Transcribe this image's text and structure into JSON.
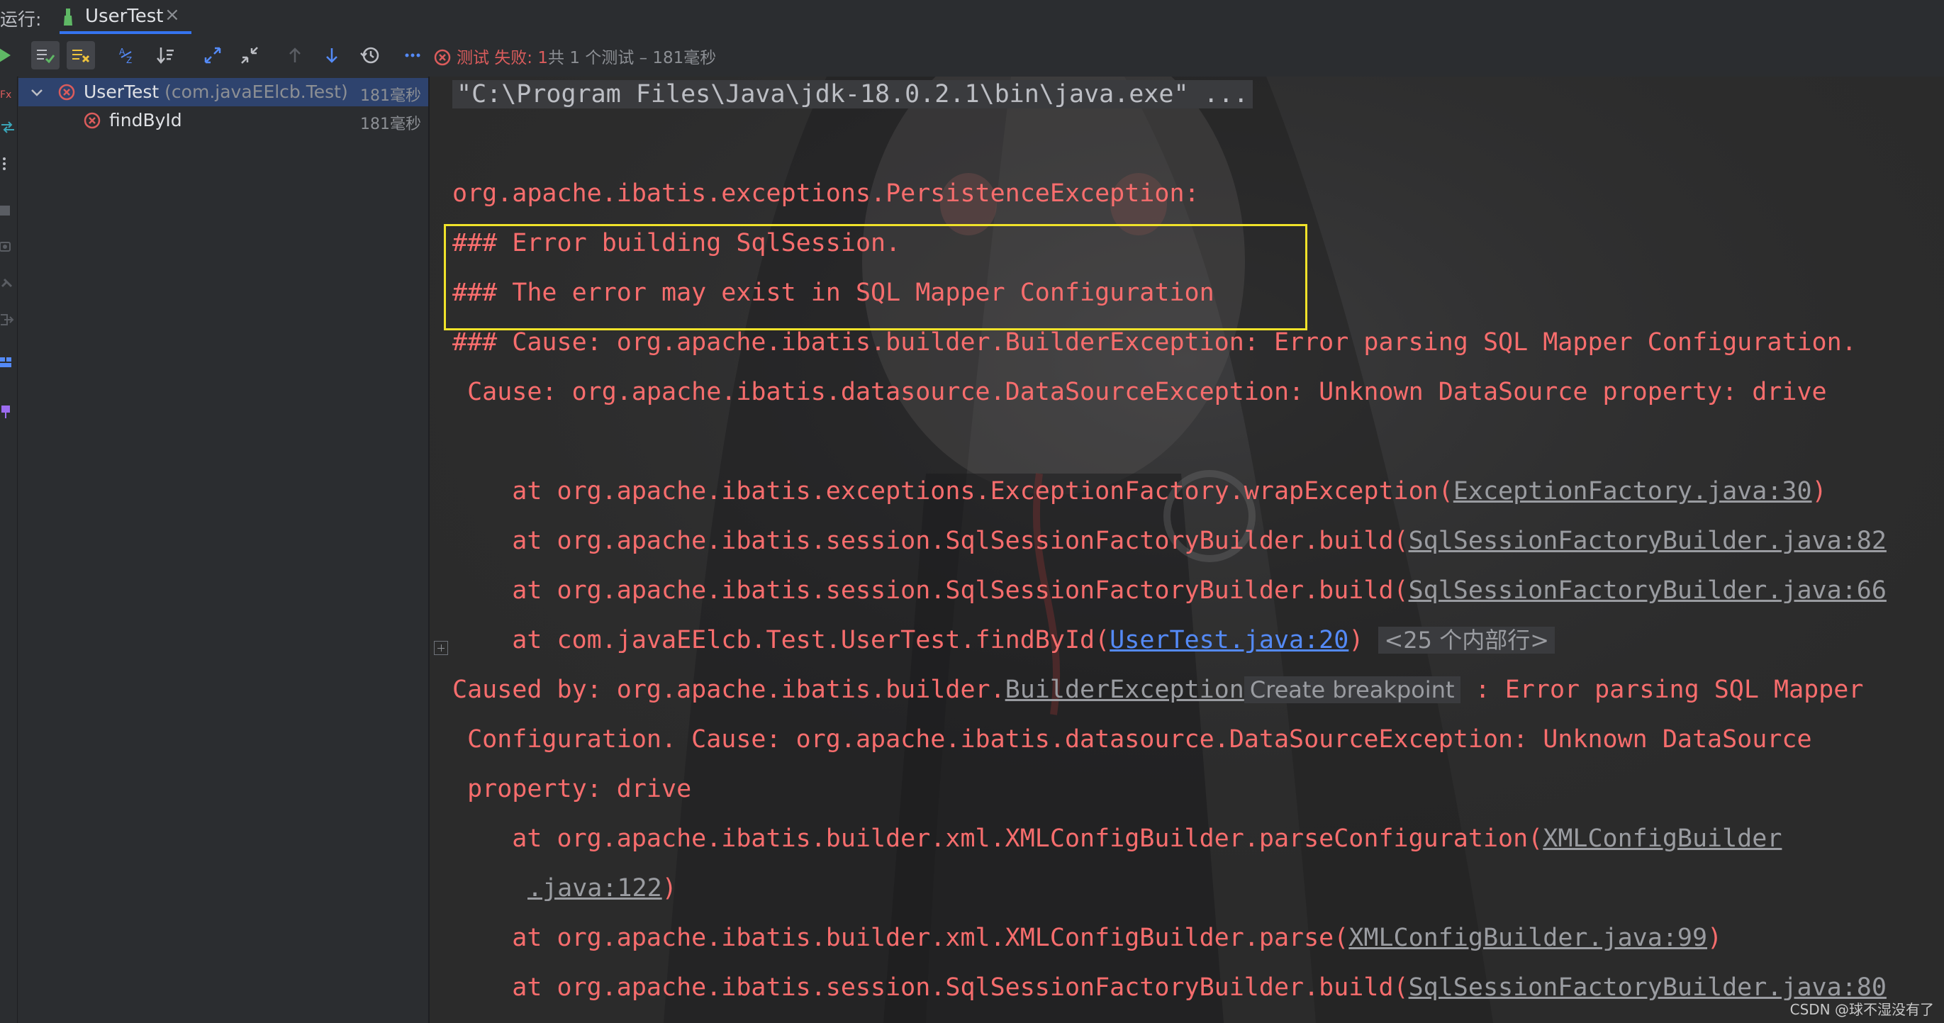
{
  "tabbar": {
    "run_label": "运行:",
    "tab_name": "UserTest",
    "close_glyph": "×"
  },
  "toolbar": {
    "buttons": [
      "rerun-icon",
      "show-passed-icon",
      "show-ignored-icon",
      "sort-alpha-icon",
      "sort-duration-icon",
      "expand-all-icon",
      "collapse-all-icon",
      "prev-failed-icon",
      "next-failed-icon",
      "history-icon",
      "more-icon"
    ],
    "status_prefix": "测试 失败: 1",
    "status_rest": "共 1 个测试 – 181毫秒"
  },
  "tree": {
    "root": {
      "name": "UserTest",
      "pkg": "(com.javaEElcb.Test)",
      "time": "181毫秒"
    },
    "child": {
      "name": "findById",
      "time": "181毫秒"
    }
  },
  "console": {
    "cmd": "\"C:\\Program Files\\Java\\jdk-18.0.2.1\\bin\\java.exe\" ...",
    "l1": "org.apache.ibatis.exceptions.PersistenceException:",
    "l2": "### Error building SqlSession.",
    "l3": "### The error may exist in SQL Mapper Configuration",
    "l4": "### Cause: org.apache.ibatis.builder.BuilderException: Error parsing SQL Mapper Configuration.",
    "l5": " Cause: org.apache.ibatis.datasource.DataSourceException: Unknown DataSource property: drive",
    "s1_pre": "    at org.apache.ibatis.exceptions.ExceptionFactory.wrapException(",
    "s1_link": "ExceptionFactory.java:30",
    "s1_post": ")",
    "s2_pre": "    at org.apache.ibatis.session.SqlSessionFactoryBuilder.build(",
    "s2_link": "SqlSessionFactoryBuilder.java:82",
    "s3_pre": "    at org.apache.ibatis.session.SqlSessionFactoryBuilder.build(",
    "s3_link": "SqlSessionFactoryBuilder.java:66",
    "s4_pre": "    at com.javaEElcb.Test.UserTest.findById(",
    "s4_link": "UserTest.java:20",
    "s4_post": ") ",
    "s4_fold": "<25 个内部行>",
    "c1_pre": "Caused by: org.apache.ibatis.builder.",
    "c1_link": "BuilderException",
    "c1_hint": "Create breakpoint",
    "c1_post": " : Error parsing SQL Mapper",
    "c2": " Configuration. Cause: org.apache.ibatis.datasource.DataSourceException: Unknown DataSource",
    "c3": " property: drive",
    "s5_pre": "    at org.apache.ibatis.builder.xml.XMLConfigBuilder.parseConfiguration(",
    "s5_link": "XMLConfigBuilder",
    "s5b_link": ".java:122",
    "s5b_post": ")",
    "s6_pre": "    at org.apache.ibatis.builder.xml.XMLConfigBuilder.parse(",
    "s6_link": "XMLConfigBuilder.java:99",
    "s6_post": ")",
    "s7_pre": "    at org.apache.ibatis.session.SqlSessionFactoryBuilder.build(",
    "s7_link": "SqlSessionFactoryBuilder.java:80"
  },
  "watermark": "CSDN @球不湿没有了",
  "colors": {
    "error_red": "#f76d6d",
    "highlight_yellow": "#f0e22a",
    "link_blue": "#548af7",
    "selection": "#2e436e"
  }
}
